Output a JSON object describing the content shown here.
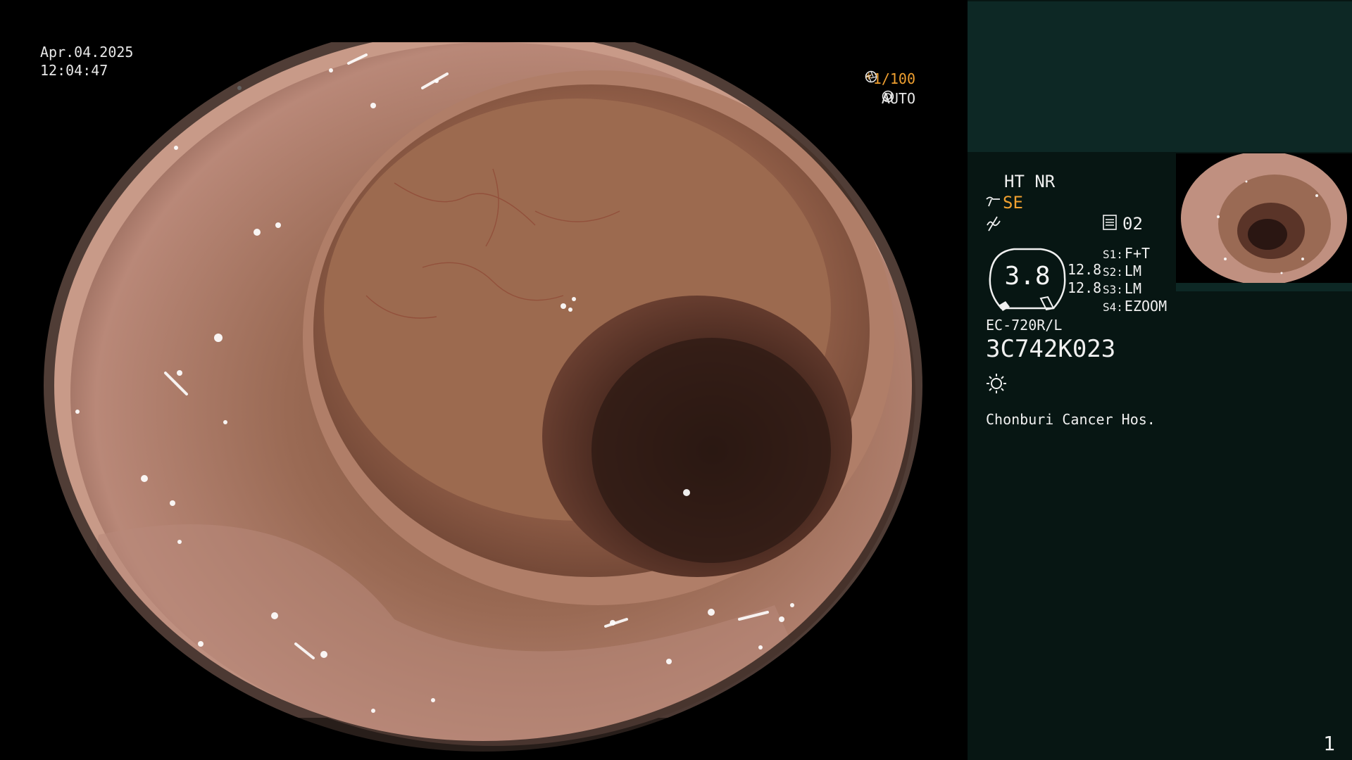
{
  "overlay": {
    "date": "Apr.04.2025",
    "time": "12:04:47",
    "shutter": "*1/100",
    "exposure_mode": "AUTO"
  },
  "panel": {
    "mode_line": "HT NR",
    "enhance": "SE",
    "memory": "02",
    "gauge_value": "3.8",
    "value_top": "12.8",
    "value_bottom": "12.8",
    "switches": [
      {
        "key": "S1:",
        "value": "F+T"
      },
      {
        "key": "S2:",
        "value": "LM"
      },
      {
        "key": "S3:",
        "value": "LM"
      },
      {
        "key": "S4:",
        "value": "EZOOM"
      }
    ],
    "scope_model": "EC-720R/L",
    "scope_serial": "3C742K023",
    "hospital": "Chonburi Cancer Hos.",
    "page_number": "1"
  },
  "icons": {
    "shutter": "aperture-icon",
    "auto": "target-icon",
    "enhance": "wave-filter-icon",
    "memory": "memo-icon",
    "light": "sun-icon"
  },
  "colors": {
    "accent": "#f0a030",
    "panel_bg": "#071613",
    "panel_header": "#0d2825"
  }
}
